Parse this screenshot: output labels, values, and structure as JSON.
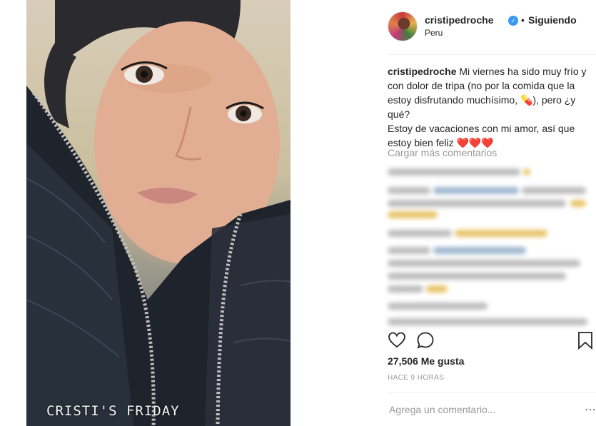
{
  "photo": {
    "overlay_text": "CRISTI'S FRIDAY"
  },
  "header": {
    "username": "cristipedroche",
    "separator": "•",
    "follow_label": "Siguiendo",
    "location": "Peru",
    "verified_icon": "check"
  },
  "caption": {
    "username": "cristipedroche",
    "line1": "Mi viernes ha sido muy frío y con dolor de tripa (no por la comida que la estoy disfrutando muchísimo, 💊), pero ¿y qué?",
    "line2": "Estoy de vacaciones con mi amor, así que estoy bien feliz ❤️❤️❤️"
  },
  "comments": {
    "load_more": "Cargar más comentarios"
  },
  "actions": {
    "like_icon": "heart-outline",
    "comment_icon": "speech-bubble",
    "save_icon": "bookmark"
  },
  "stats": {
    "likes": "27,506 Me gusta",
    "time": "HACE 9 HORAS"
  },
  "input": {
    "placeholder": "Agrega un comentario..."
  },
  "colors": {
    "link_blue": "#3897f0",
    "muted": "#999999",
    "text": "#262626"
  }
}
